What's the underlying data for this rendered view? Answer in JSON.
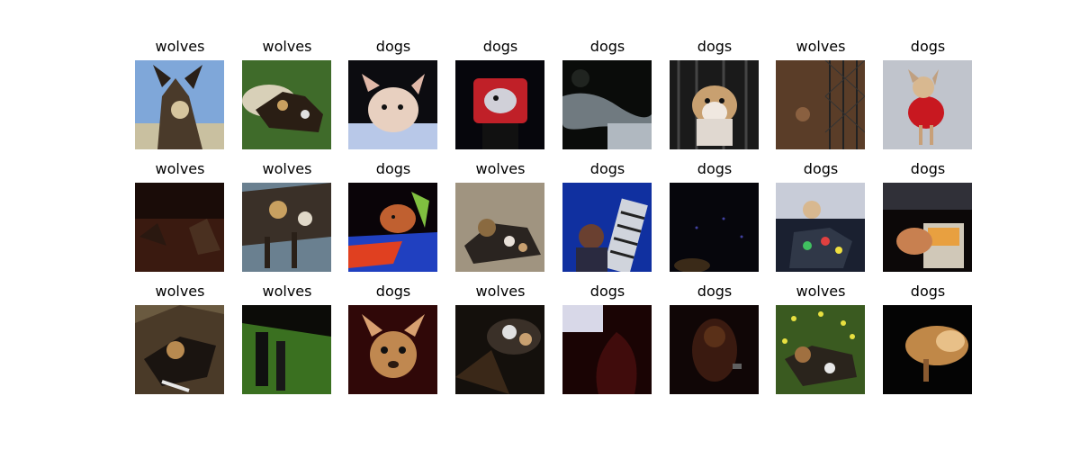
{
  "grid": {
    "labels": [
      [
        "wolves",
        "wolves",
        "dogs",
        "dogs",
        "dogs",
        "dogs",
        "wolves",
        "dogs"
      ],
      [
        "wolves",
        "wolves",
        "dogs",
        "wolves",
        "dogs",
        "dogs",
        "dogs",
        "dogs"
      ],
      [
        "wolves",
        "wolves",
        "dogs",
        "wolves",
        "dogs",
        "dogs",
        "wolves",
        "dogs"
      ]
    ]
  },
  "image_descriptions": [
    "African wild dog against blue sky",
    "wild dogs on grass",
    "chihuahua puppy on blanket",
    "chihuahua in red harness",
    "dark snowy scene",
    "husky puppy in cage",
    "leaf litter by fence",
    "chihuahua in red dress",
    "dark reddish scene with animals",
    "wild dog legs close-up",
    "chihuahua on colorful pillow",
    "wild dog lying on sand",
    "person by building blue sky",
    "very dark scene",
    "small dog with toys",
    "dog by laptop",
    "wild dog head close-up",
    "wild dog in grass",
    "chihuahua on red background",
    "wild dog dark scene",
    "dark red scene",
    "dark dog scene",
    "wild dog among yellow flowers",
    "dog in dark light"
  ]
}
